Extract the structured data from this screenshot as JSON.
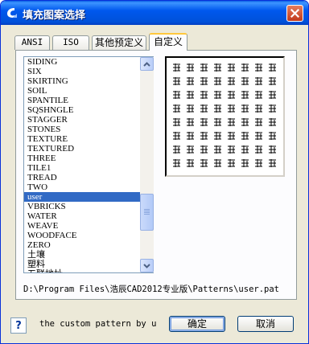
{
  "window": {
    "title": "填充图案选择"
  },
  "tabs": [
    {
      "label": "ANSI",
      "active": false
    },
    {
      "label": "ISO",
      "active": false
    },
    {
      "label": "其他预定义",
      "active": false
    },
    {
      "label": "自定义",
      "active": true
    }
  ],
  "pattern_list": {
    "items": [
      "SIDING",
      "SIX",
      "SKIRTING",
      "SOIL",
      "SPANTILE",
      "SQSHNGLE",
      "STAGGER",
      "STONES",
      "TEXTURE",
      "TEXTURED",
      "THREE",
      "TILE1",
      "TREAD",
      "TWO",
      "user",
      "VBRICKS",
      "WATER",
      "WEAVE",
      "WOODFACE",
      "ZERO",
      "土壤",
      "塑料",
      "五联地址"
    ],
    "selected_index": 14
  },
  "pattern_path": "D:\\Program Files\\浩辰CAD2012专业版\\Patterns\\user.pat",
  "description": "the custom pattern by user",
  "buttons": {
    "ok": "确定",
    "cancel": "取消",
    "help": "?"
  },
  "colors": {
    "selection": "#316ac5",
    "titlebar": "#0058ee",
    "dialog_bg": "#ece9d8"
  },
  "icons": {
    "app": "app-logo-icon",
    "close": "close-icon",
    "scroll_up": "chevron-up-icon",
    "scroll_down": "chevron-down-icon"
  }
}
